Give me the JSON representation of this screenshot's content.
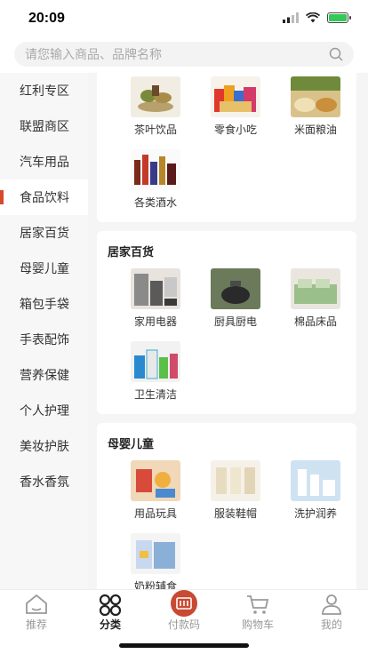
{
  "status": {
    "time": "20:09"
  },
  "search": {
    "placeholder": "请您输入商品、品牌名称"
  },
  "sidebar": {
    "items": [
      {
        "label": "红利专区"
      },
      {
        "label": "联盟商区"
      },
      {
        "label": "汽车用品"
      },
      {
        "label": "食品饮料"
      },
      {
        "label": "居家百货"
      },
      {
        "label": "母婴儿童"
      },
      {
        "label": "箱包手袋"
      },
      {
        "label": "手表配饰"
      },
      {
        "label": "营养保健"
      },
      {
        "label": "个人护理"
      },
      {
        "label": "美妆护肤"
      },
      {
        "label": "香水香氛"
      }
    ]
  },
  "sections": [
    {
      "title": "",
      "items": [
        {
          "label": "茶叶饮品"
        },
        {
          "label": "零食小吃"
        },
        {
          "label": "米面粮油"
        },
        {
          "label": "各类酒水"
        }
      ]
    },
    {
      "title": "居家百货",
      "items": [
        {
          "label": "家用电器"
        },
        {
          "label": "厨具厨电"
        },
        {
          "label": "棉品床品"
        },
        {
          "label": "卫生清洁"
        }
      ]
    },
    {
      "title": "母婴儿童",
      "items": [
        {
          "label": "用品玩具"
        },
        {
          "label": "服装鞋帽"
        },
        {
          "label": "洗护润养"
        },
        {
          "label": "奶粉辅食"
        }
      ]
    }
  ],
  "tabbar": {
    "items": [
      {
        "label": "推荐"
      },
      {
        "label": "分类"
      },
      {
        "label": "付款码"
      },
      {
        "label": "购物车"
      },
      {
        "label": "我的"
      }
    ]
  },
  "colors": {
    "accent": "#d9482b",
    "active_tab": "#222222",
    "inactive_tab": "#999999"
  }
}
